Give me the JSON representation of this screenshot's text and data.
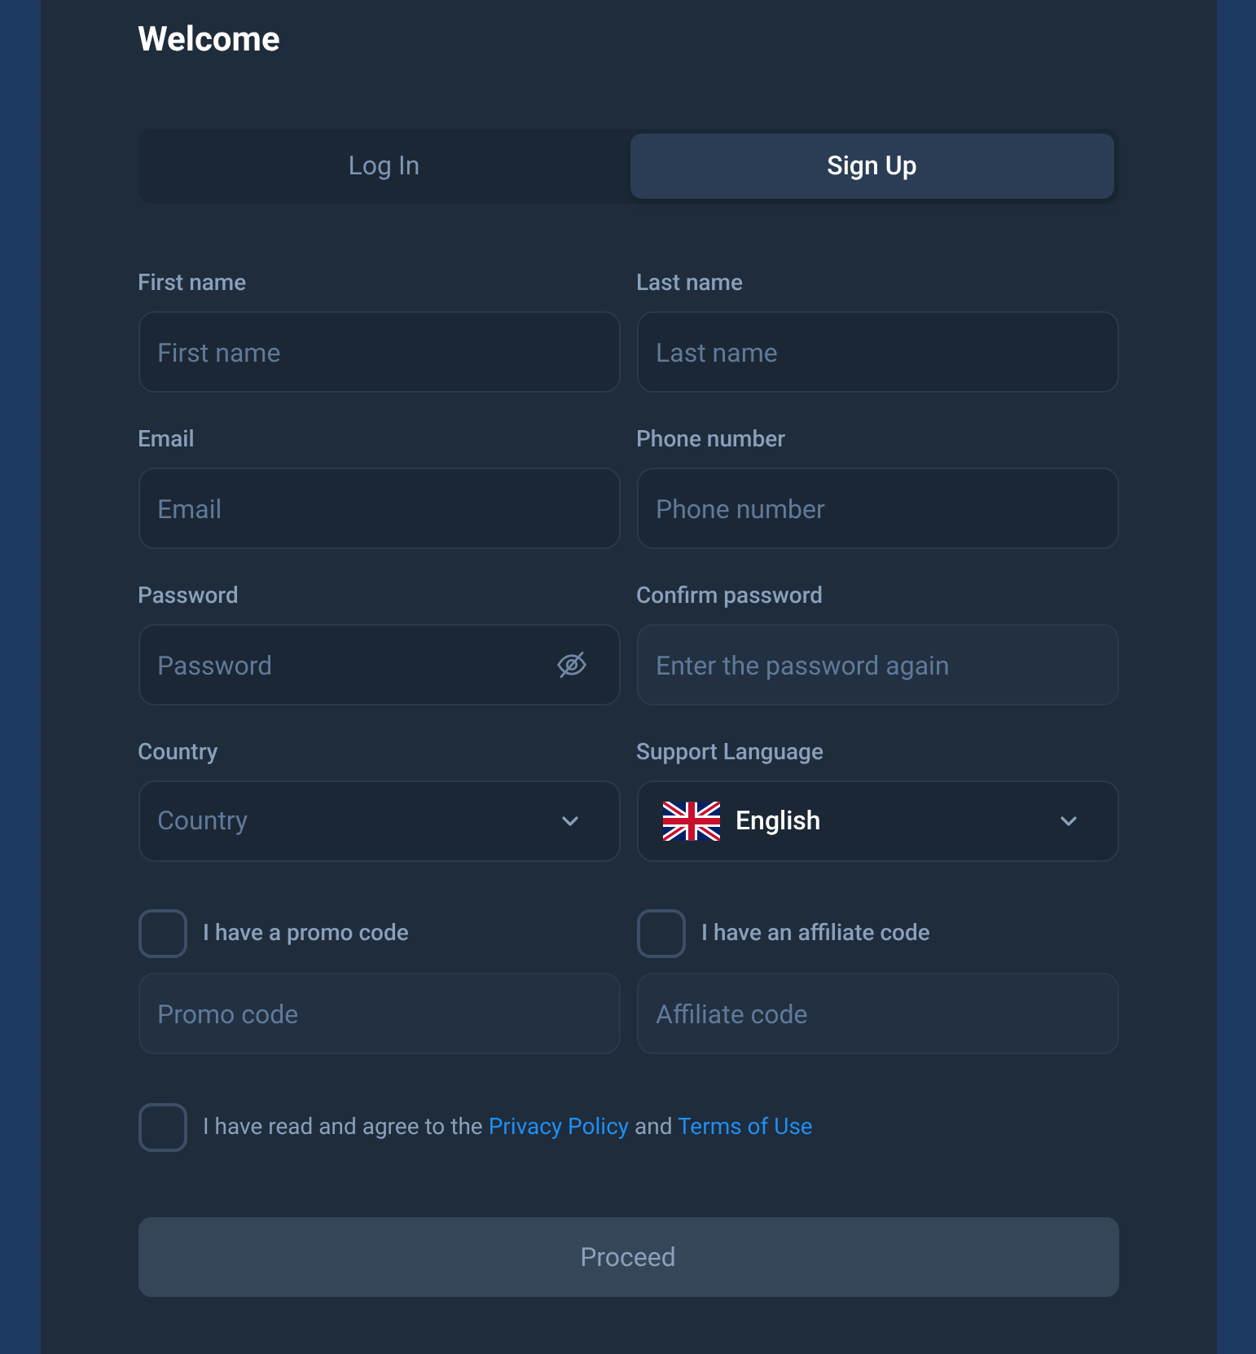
{
  "title": "Welcome",
  "tabs": [
    {
      "label": "Log In",
      "selected": false
    },
    {
      "label": "Sign Up",
      "selected": true
    }
  ],
  "fields": [
    {
      "label": "First name",
      "placeholder": "First name",
      "kind": "text",
      "disabled": false
    },
    {
      "label": "Last name",
      "placeholder": "Last name",
      "kind": "text",
      "disabled": false
    },
    {
      "label": "Email",
      "placeholder": "Email",
      "kind": "text",
      "disabled": false
    },
    {
      "label": "Phone number",
      "placeholder": "Phone number",
      "kind": "text",
      "disabled": false
    },
    {
      "label": "Password",
      "placeholder": "Password",
      "kind": "password",
      "disabled": false
    },
    {
      "label": "Confirm password",
      "placeholder": "Enter the password again",
      "kind": "text",
      "disabled": true
    },
    {
      "label": "Country",
      "placeholder": "Country",
      "kind": "select",
      "disabled": false
    },
    {
      "label": "Support Language",
      "value": "English",
      "kind": "language",
      "disabled": false
    }
  ],
  "code_options": [
    {
      "label": "I have a promo code",
      "checked": false,
      "placeholder": "Promo code",
      "disabled": true
    },
    {
      "label": "I have an affiliate code",
      "checked": false,
      "placeholder": "Affiliate code",
      "disabled": true
    }
  ],
  "agreement": {
    "checked": false,
    "text_before": "I have read and agree to the",
    "link_1": "Privacy Policy",
    "text_middle": "and",
    "link_2": "Terms of Use"
  },
  "proceed": {
    "label": "Proceed",
    "disabled": true
  }
}
